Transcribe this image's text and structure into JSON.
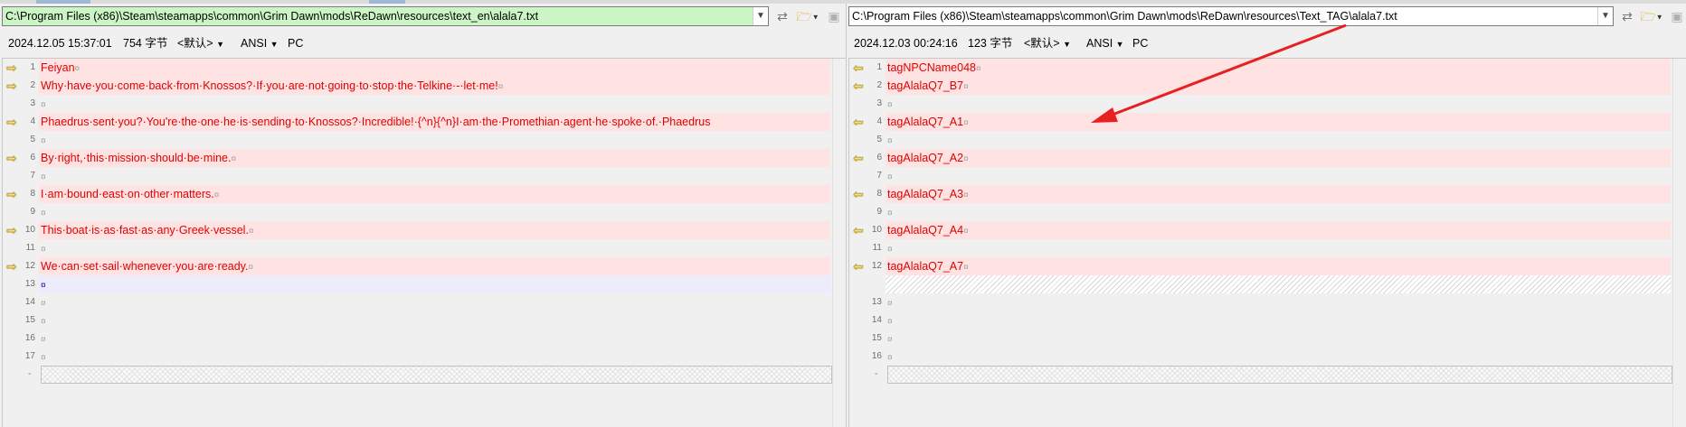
{
  "colors": {
    "diff_line_bg": "#ffe3e3",
    "diff_text": "#e00000",
    "path_highlight": "#ccf5c5",
    "annotation_arrow": "#e82020"
  },
  "left": {
    "path": "C:\\Program Files (x86)\\Steam\\steamapps\\common\\Grim Dawn\\mods\\ReDawn\\resources\\text_en\\alala7.txt",
    "timestamp": "2024.12.05 15:37:01",
    "size": "754 字节",
    "encoding_default": "<默认>",
    "charset": "ANSI",
    "line_ending": "PC",
    "lines": [
      {
        "num": "1",
        "text": "Feiyan",
        "eol": "¤"
      },
      {
        "num": "2",
        "text": "Why·have·you·come·back·from·Knossos?·If·you·are·not·going·to·stop·the·Telkine·-·let·me!",
        "eol": "¤"
      },
      {
        "num": "3",
        "text": "",
        "eol": "¤"
      },
      {
        "num": "4",
        "text": "Phaedrus·sent·you?·You're·the·one·he·is·sending·to·Knossos?·Incredible!·{^n}{^n}I·am·the·Promethian·agent·he·spoke·of.·Phaedrus",
        "eol": ""
      },
      {
        "num": "5",
        "text": "",
        "eol": "¤"
      },
      {
        "num": "6",
        "text": "By·right,·this·mission·should·be·mine.",
        "eol": "¤"
      },
      {
        "num": "7",
        "text": "",
        "eol": "¤"
      },
      {
        "num": "8",
        "text": "I·am·bound·east·on·other·matters.",
        "eol": "¤"
      },
      {
        "num": "9",
        "text": "",
        "eol": "¤"
      },
      {
        "num": "10",
        "text": "This·boat·is·as·fast·as·any·Greek·vessel.",
        "eol": "¤"
      },
      {
        "num": "11",
        "text": "",
        "eol": "¤"
      },
      {
        "num": "12",
        "text": "We·can·set·sail·whenever·you·are·ready.",
        "eol": "¤"
      },
      {
        "num": "13",
        "text": "",
        "eol": "¤"
      },
      {
        "num": "14",
        "text": "",
        "eol": "¤"
      },
      {
        "num": "15",
        "text": "",
        "eol": "¤"
      },
      {
        "num": "16",
        "text": "",
        "eol": "¤"
      },
      {
        "num": "17",
        "text": "",
        "eol": "¤"
      }
    ],
    "end_marker": "-"
  },
  "right": {
    "path": "C:\\Program Files (x86)\\Steam\\steamapps\\common\\Grim Dawn\\mods\\ReDawn\\resources\\Text_TAG\\alala7.txt",
    "timestamp": "2024.12.03 00:24:16",
    "size": "123 字节",
    "encoding_default": "<默认>",
    "charset": "ANSI",
    "line_ending": "PC",
    "lines": [
      {
        "num": "1",
        "text": "tagNPCName048",
        "eol": "¤"
      },
      {
        "num": "2",
        "text": "tagAlalaQ7_B7",
        "eol": "¤"
      },
      {
        "num": "3",
        "text": "",
        "eol": "¤"
      },
      {
        "num": "4",
        "text": "tagAlalaQ7_A1",
        "eol": "¤"
      },
      {
        "num": "5",
        "text": "",
        "eol": "¤"
      },
      {
        "num": "6",
        "text": "tagAlalaQ7_A2",
        "eol": "¤"
      },
      {
        "num": "7",
        "text": "",
        "eol": "¤"
      },
      {
        "num": "8",
        "text": "tagAlalaQ7_A3",
        "eol": "¤"
      },
      {
        "num": "9",
        "text": "",
        "eol": "¤"
      },
      {
        "num": "10",
        "text": "tagAlalaQ7_A4",
        "eol": "¤"
      },
      {
        "num": "11",
        "text": "",
        "eol": "¤"
      },
      {
        "num": "12",
        "text": "tagAlalaQ7_A7",
        "eol": "¤"
      },
      {
        "num": "13",
        "text": "",
        "eol": "¤"
      },
      {
        "num": "14",
        "text": "",
        "eol": "¤"
      },
      {
        "num": "15",
        "text": "",
        "eol": "¤"
      },
      {
        "num": "16",
        "text": "",
        "eol": "¤"
      }
    ],
    "end_marker": "-"
  }
}
